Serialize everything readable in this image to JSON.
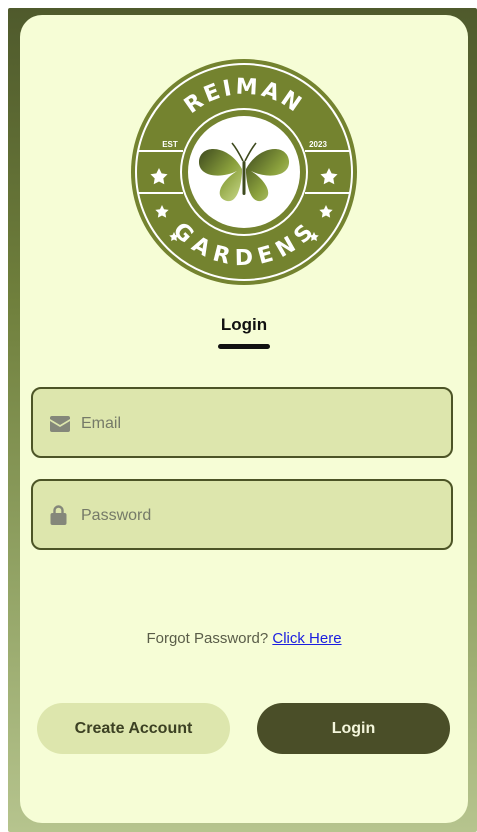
{
  "logo": {
    "brand_top": "REIMAN",
    "brand_bottom": "GARDENS",
    "est_label": "EST",
    "year": "2023",
    "emblem": "butterfly-icon"
  },
  "tab": {
    "title": "Login"
  },
  "form": {
    "email": {
      "placeholder": "Email",
      "value": "",
      "icon": "envelope-icon"
    },
    "password": {
      "placeholder": "Password",
      "value": "",
      "icon": "lock-icon"
    }
  },
  "forgot": {
    "text": "Forgot Password?",
    "link_label": "Click Here"
  },
  "buttons": {
    "create_account": "Create Account",
    "login": "Login"
  },
  "colors": {
    "card_bg": "#f6fdd6",
    "field_bg": "#dde6ad",
    "primary": "#4a4e28",
    "logo_green": "#74832f",
    "link": "#1b1ee0"
  }
}
